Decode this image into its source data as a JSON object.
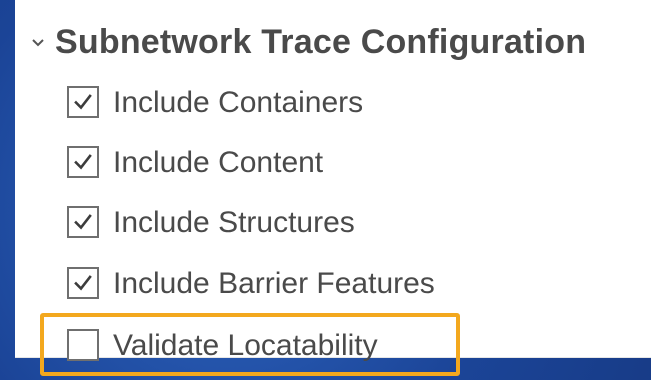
{
  "section": {
    "title": "Subnetwork Trace Configuration",
    "expanded": true,
    "chevron_icon": "chevron-down-icon"
  },
  "options": [
    {
      "label": "Include Containers",
      "checked": true
    },
    {
      "label": "Include Content",
      "checked": true
    },
    {
      "label": "Include Structures",
      "checked": true
    },
    {
      "label": "Include Barrier Features",
      "checked": true
    },
    {
      "label": "Validate Locatability",
      "checked": false
    }
  ],
  "highlight": {
    "target": "Validate Locatability",
    "color": "#f3a81e"
  },
  "colors": {
    "panel_bg": "#ffffff",
    "text": "#4a4a4a",
    "checkbox_border": "#6f6f6f",
    "background": "#1f4ea3"
  }
}
